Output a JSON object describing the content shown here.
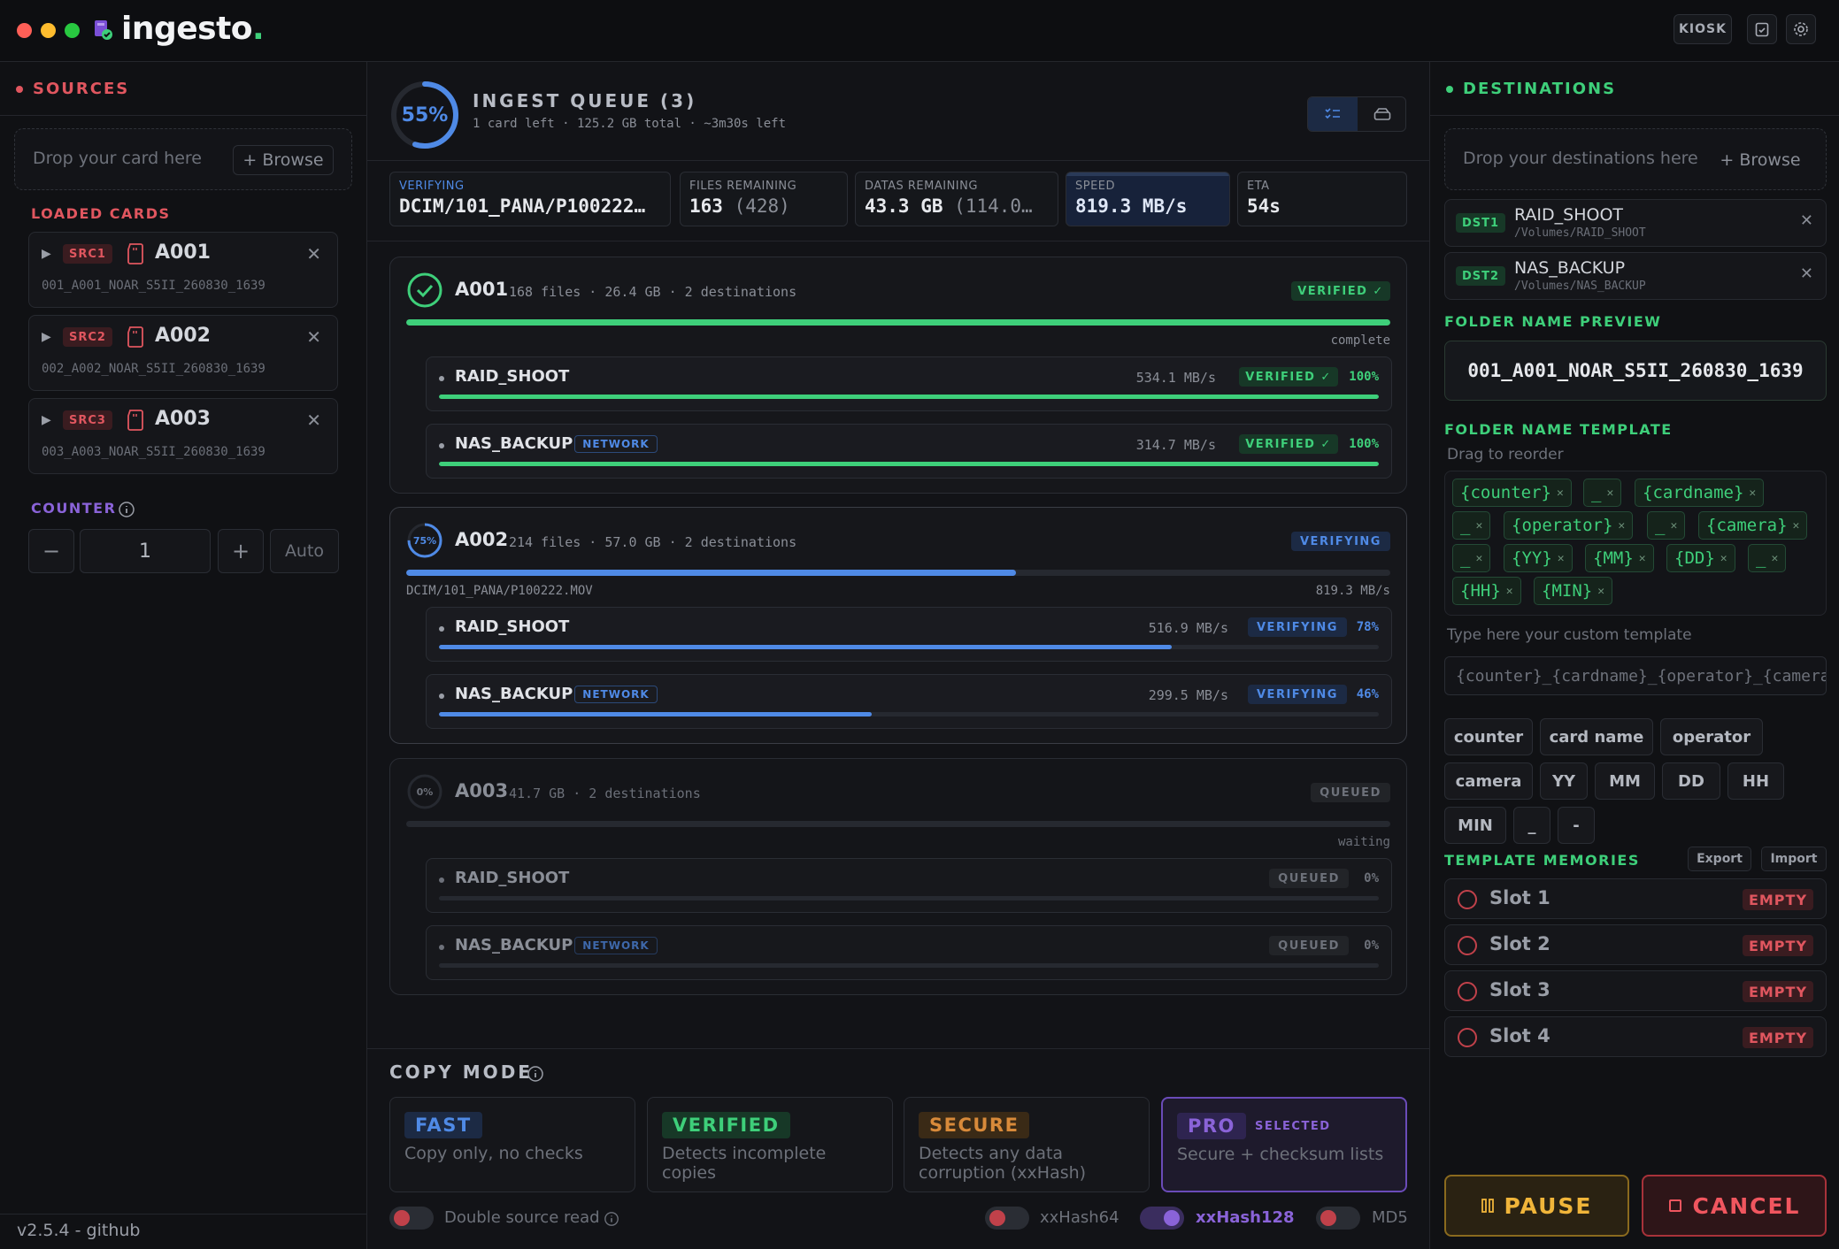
{
  "app": {
    "brand": "ingesto",
    "brand_dot": ".",
    "kiosk_label": "KIOSK",
    "version": "v2.5.4 - github",
    "colors": {
      "accent_green": "#3ecf7a",
      "accent_red": "#e0565f",
      "accent_blue": "#4f8ae6",
      "accent_purple": "#8a63d8",
      "accent_orange": "#d88a3a",
      "bg": "#0f1013"
    }
  },
  "sources": {
    "title": "SOURCES",
    "drop_text": "Drop your card here",
    "browse_label": "+ Browse",
    "loaded_title": "LOADED CARDS",
    "cards": [
      {
        "badge": "SRC1",
        "name": "A001",
        "folder": "001_A001_NOAR_S5II_260830_1639"
      },
      {
        "badge": "SRC2",
        "name": "A002",
        "folder": "002_A002_NOAR_S5II_260830_1639"
      },
      {
        "badge": "SRC3",
        "name": "A003",
        "folder": "003_A003_NOAR_S5II_260830_1639"
      }
    ],
    "counter_title": "COUNTER",
    "counter_minus": "−",
    "counter_value": "1",
    "counter_plus": "+",
    "counter_auto": "Auto"
  },
  "queue": {
    "progress_label": "55%",
    "progress_value": 0.55,
    "title": "INGEST QUEUE (3)",
    "subtitle": "1 card left · 125.2 GB total · ~3m30s left",
    "stats": {
      "verifying_label": "VERIFYING",
      "verifying_value": "DCIM/101_PANA/P100222…",
      "files_label": "FILES REMAINING",
      "files_value": "163",
      "files_total": "(428)",
      "datas_label": "DATAS REMAINING",
      "datas_value": "43.3 GB",
      "datas_total": "(114.0…",
      "speed_label": "SPEED",
      "speed_value": "819.3 MB/s",
      "eta_label": "ETA",
      "eta_value": "54s"
    },
    "network_label": "NETWORK",
    "cards": [
      {
        "name": "A001",
        "sub": "168 files · 26.4 GB · 2 destinations",
        "status": "VERIFIED ✓",
        "progress": 1.0,
        "note_right": "complete",
        "note_left": "",
        "dests": [
          {
            "name": "RAID_SHOOT",
            "speed": "534.1 MB/s",
            "status": "VERIFIED ✓",
            "pct": "100%",
            "progress": 1.0,
            "network": false
          },
          {
            "name": "NAS_BACKUP",
            "speed": "314.7 MB/s",
            "status": "VERIFIED ✓",
            "pct": "100%",
            "progress": 1.0,
            "network": true
          }
        ]
      },
      {
        "name": "A002",
        "sub": "214 files · 57.0 GB · 2 destinations",
        "status": "VERIFYING",
        "ring": "75%",
        "progress": 0.62,
        "note_right": "819.3 MB/s",
        "note_left": "DCIM/101_PANA/P100222.MOV",
        "dests": [
          {
            "name": "RAID_SHOOT",
            "speed": "516.9 MB/s",
            "status": "VERIFYING",
            "pct": "78%",
            "progress": 0.78,
            "network": false
          },
          {
            "name": "NAS_BACKUP",
            "speed": "299.5 MB/s",
            "status": "VERIFYING",
            "pct": "46%",
            "progress": 0.46,
            "network": true
          }
        ]
      },
      {
        "name": "A003",
        "sub": "41.7 GB · 2 destinations",
        "status": "QUEUED",
        "ring": "0%",
        "progress": 0.0,
        "note_right": "waiting",
        "note_left": "",
        "dests": [
          {
            "name": "RAID_SHOOT",
            "speed": "",
            "status": "QUEUED",
            "pct": "0%",
            "progress": 0.0,
            "network": false
          },
          {
            "name": "NAS_BACKUP",
            "speed": "",
            "status": "QUEUED",
            "pct": "0%",
            "progress": 0.0,
            "network": true
          }
        ]
      }
    ]
  },
  "copy_mode": {
    "title": "COPY MODE",
    "modes": [
      {
        "tag": "FAST",
        "desc": "Copy only, no checks"
      },
      {
        "tag": "VERIFIED",
        "desc": "Detects incomplete copies"
      },
      {
        "tag": "SECURE",
        "desc": "Detects any data corruption (xxHash)"
      },
      {
        "tag": "PRO",
        "selected": "SELECTED",
        "desc": "Secure + checksum lists"
      }
    ],
    "double_source": "Double source read",
    "hash_options": [
      "xxHash64",
      "xxHash128",
      "MD5"
    ]
  },
  "destinations": {
    "title": "DESTINATIONS",
    "drop_text": "Drop your destinations here",
    "browse_label": "+ Browse",
    "items": [
      {
        "badge": "DST1",
        "name": "RAID_SHOOT",
        "path": "/Volumes/RAID_SHOOT"
      },
      {
        "badge": "DST2",
        "name": "NAS_BACKUP",
        "path": "/Volumes/NAS_BACKUP"
      }
    ],
    "preview_title": "FOLDER NAME PREVIEW",
    "preview_value": "001_A001_NOAR_S5II_260830_1639",
    "template_title": "FOLDER NAME TEMPLATE",
    "template_hint": "Drag to reorder",
    "chips": [
      "{counter}",
      "_",
      "{cardname}",
      "_",
      "{operator}",
      "_",
      "{camera}",
      "_",
      "{YY}",
      "{MM}",
      "{DD}",
      "_",
      "{HH}",
      "{MIN}"
    ],
    "custom_label": "Type here your custom template",
    "custom_value": "{counter}_{cardname}_{operator}_{camera}_{YY}{MM}{DD}_{HH}{MIN}",
    "tokens": [
      "counter",
      "card name",
      "operator",
      "camera",
      "YY",
      "MM",
      "DD",
      "HH",
      "MIN",
      "_",
      "-"
    ],
    "memories_title": "TEMPLATE MEMORIES",
    "export_label": "Export",
    "import_label": "Import",
    "slots": [
      {
        "name": "Slot 1",
        "state": "EMPTY"
      },
      {
        "name": "Slot 2",
        "state": "EMPTY"
      },
      {
        "name": "Slot 3",
        "state": "EMPTY"
      },
      {
        "name": "Slot 4",
        "state": "EMPTY"
      }
    ],
    "pause_label": "PAUSE",
    "cancel_label": "CANCEL"
  }
}
